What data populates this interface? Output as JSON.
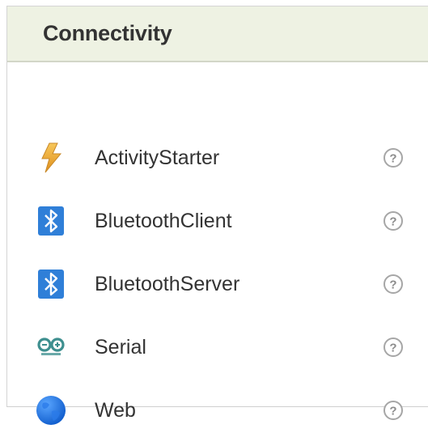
{
  "palette": {
    "header_bg": "#eef2e3",
    "text": "#333333",
    "bluetooth_blue": "#2f7fd8",
    "help_gray": "#a6a6a6"
  },
  "header": {
    "title": "Connectivity"
  },
  "components": [
    {
      "label": "ActivityStarter",
      "icon": "lightning-icon"
    },
    {
      "label": "BluetoothClient",
      "icon": "bluetooth-icon"
    },
    {
      "label": "BluetoothServer",
      "icon": "bluetooth-icon"
    },
    {
      "label": "Serial",
      "icon": "arduino-icon"
    },
    {
      "label": "Web",
      "icon": "globe-icon"
    }
  ],
  "help_symbol": "?"
}
